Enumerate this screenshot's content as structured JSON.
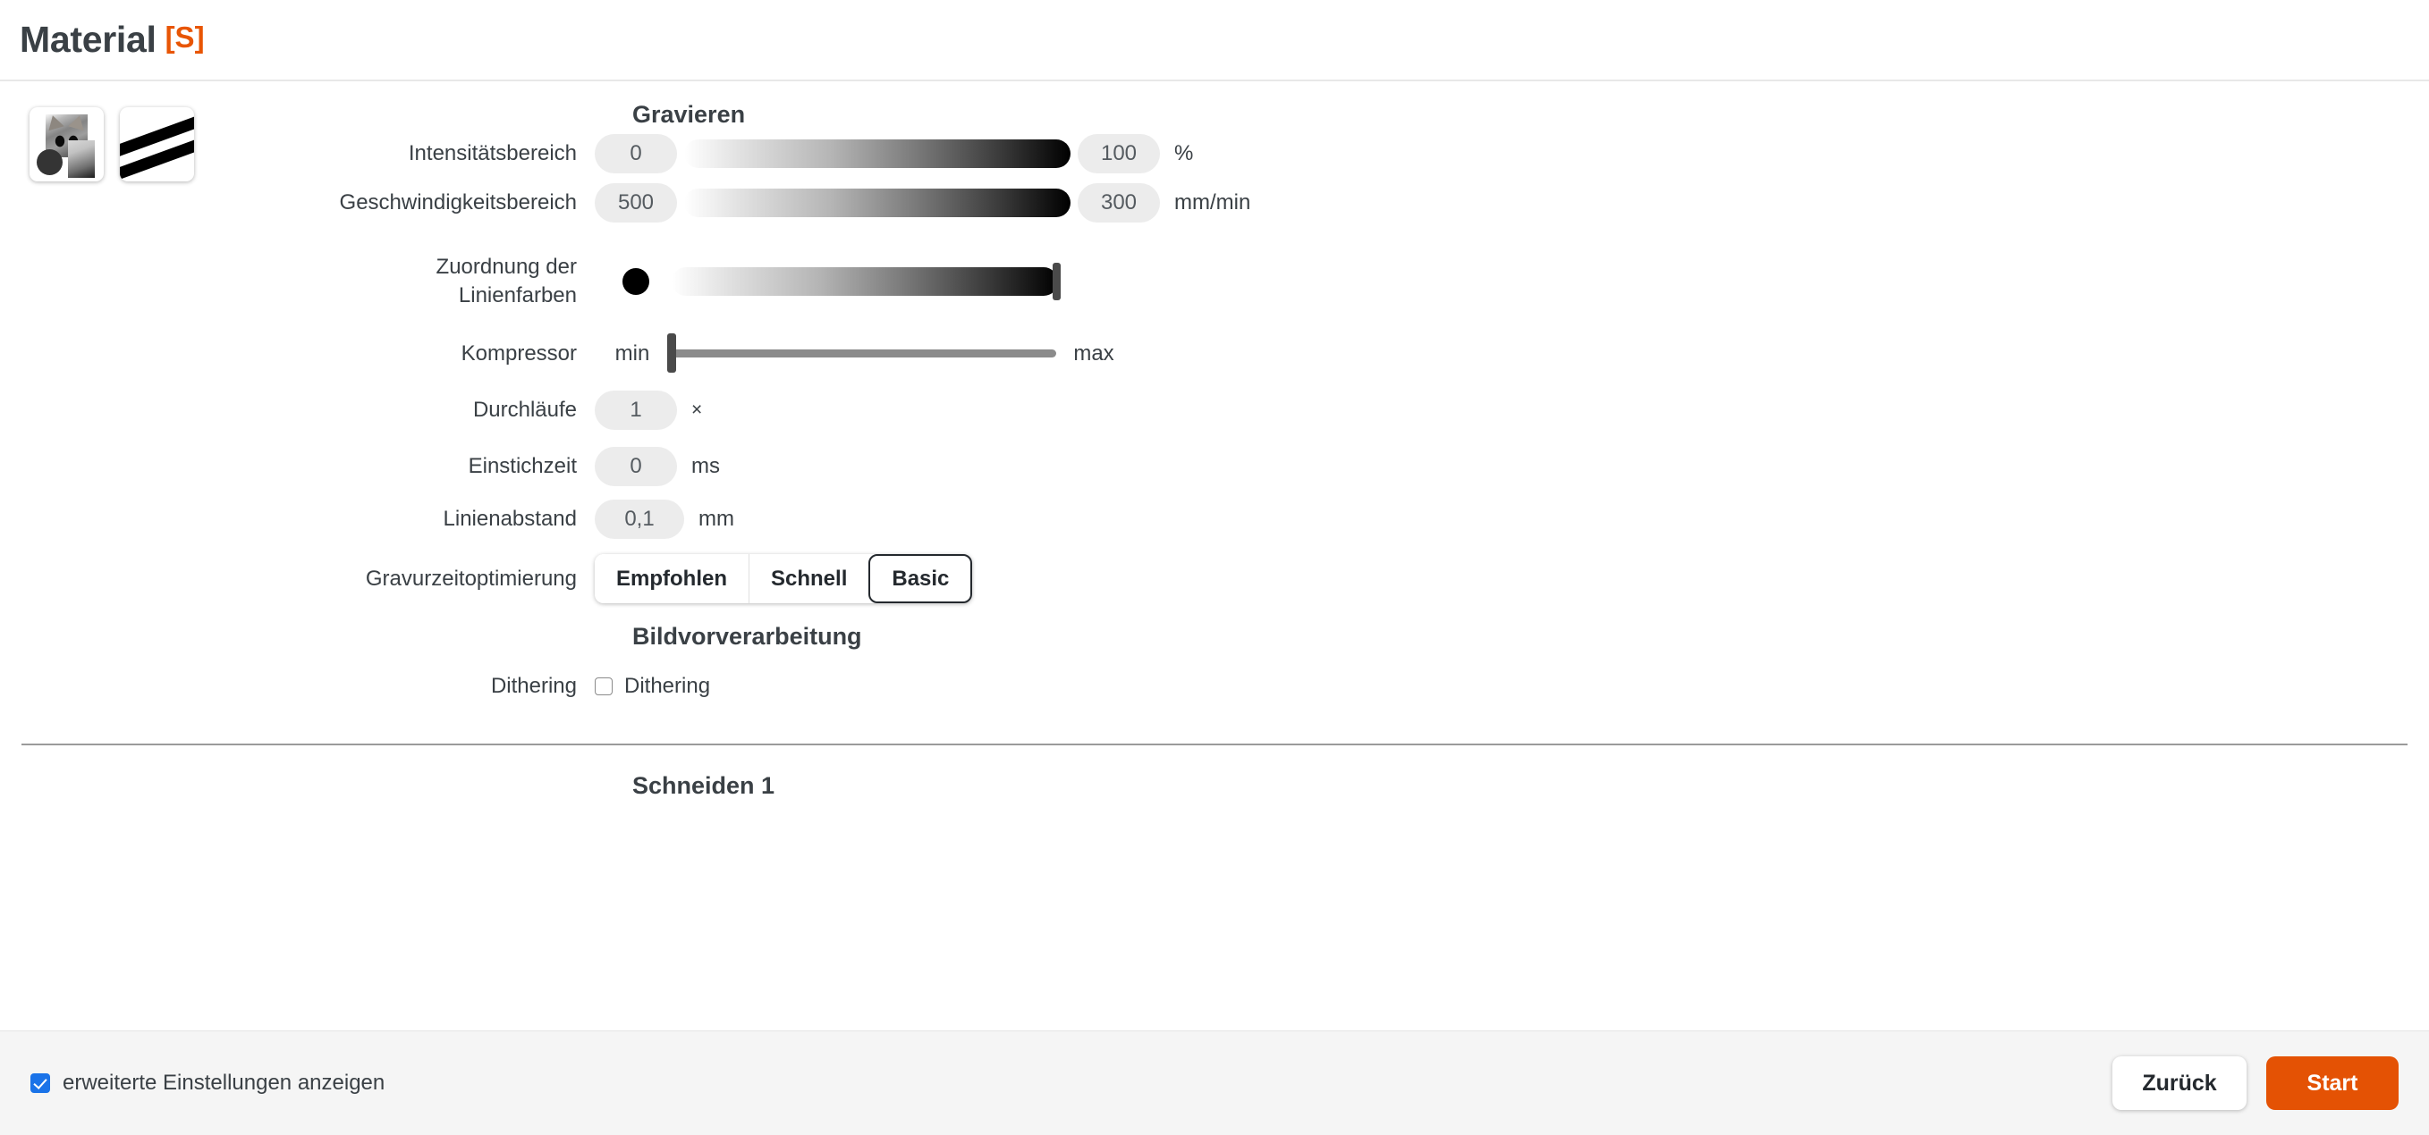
{
  "header": {
    "title": "Material",
    "badge": "[S]"
  },
  "thumbnails": [
    {
      "name": "cat-image-thumbnail"
    },
    {
      "name": "stripes-thumbnail"
    }
  ],
  "sections": {
    "gravieren": {
      "title": "Gravieren",
      "intensity": {
        "label": "Intensitätsbereich",
        "min_value": "0",
        "max_value": "100",
        "unit": "%"
      },
      "speed": {
        "label": "Geschwindigkeitsbereich",
        "min_value": "500",
        "max_value": "300",
        "unit": "mm/min"
      },
      "line_color_mapping": {
        "label_line1": "Zuordnung der",
        "label_line2": "Linienfarben",
        "color": "#000000"
      },
      "compressor": {
        "label": "Kompressor",
        "min_label": "min",
        "max_label": "max"
      },
      "passes": {
        "label": "Durchläufe",
        "value": "1",
        "unit": "×"
      },
      "pierce_time": {
        "label": "Einstichzeit",
        "value": "0",
        "unit": "ms"
      },
      "line_spacing": {
        "label": "Linienabstand",
        "value": "0,1",
        "unit": "mm"
      },
      "optimization": {
        "label": "Gravurzeitoptimierung",
        "options": [
          "Empfohlen",
          "Schnell",
          "Basic"
        ],
        "selected": "Basic"
      }
    },
    "bildvorverarbeitung": {
      "title": "Bildvorverarbeitung",
      "dithering": {
        "label": "Dithering",
        "checkbox_label": "Dithering",
        "checked": false
      }
    },
    "schneiden": {
      "title": "Schneiden 1"
    }
  },
  "footer": {
    "advanced_settings_label": "erweiterte Einstellungen anzeigen",
    "advanced_settings_checked": true,
    "back_label": "Zurück",
    "start_label": "Start"
  },
  "colors": {
    "accent_orange": "#e45204",
    "badge_orange": "#e85504",
    "checkbox_blue": "#1a73e8",
    "text": "#3a4045"
  }
}
